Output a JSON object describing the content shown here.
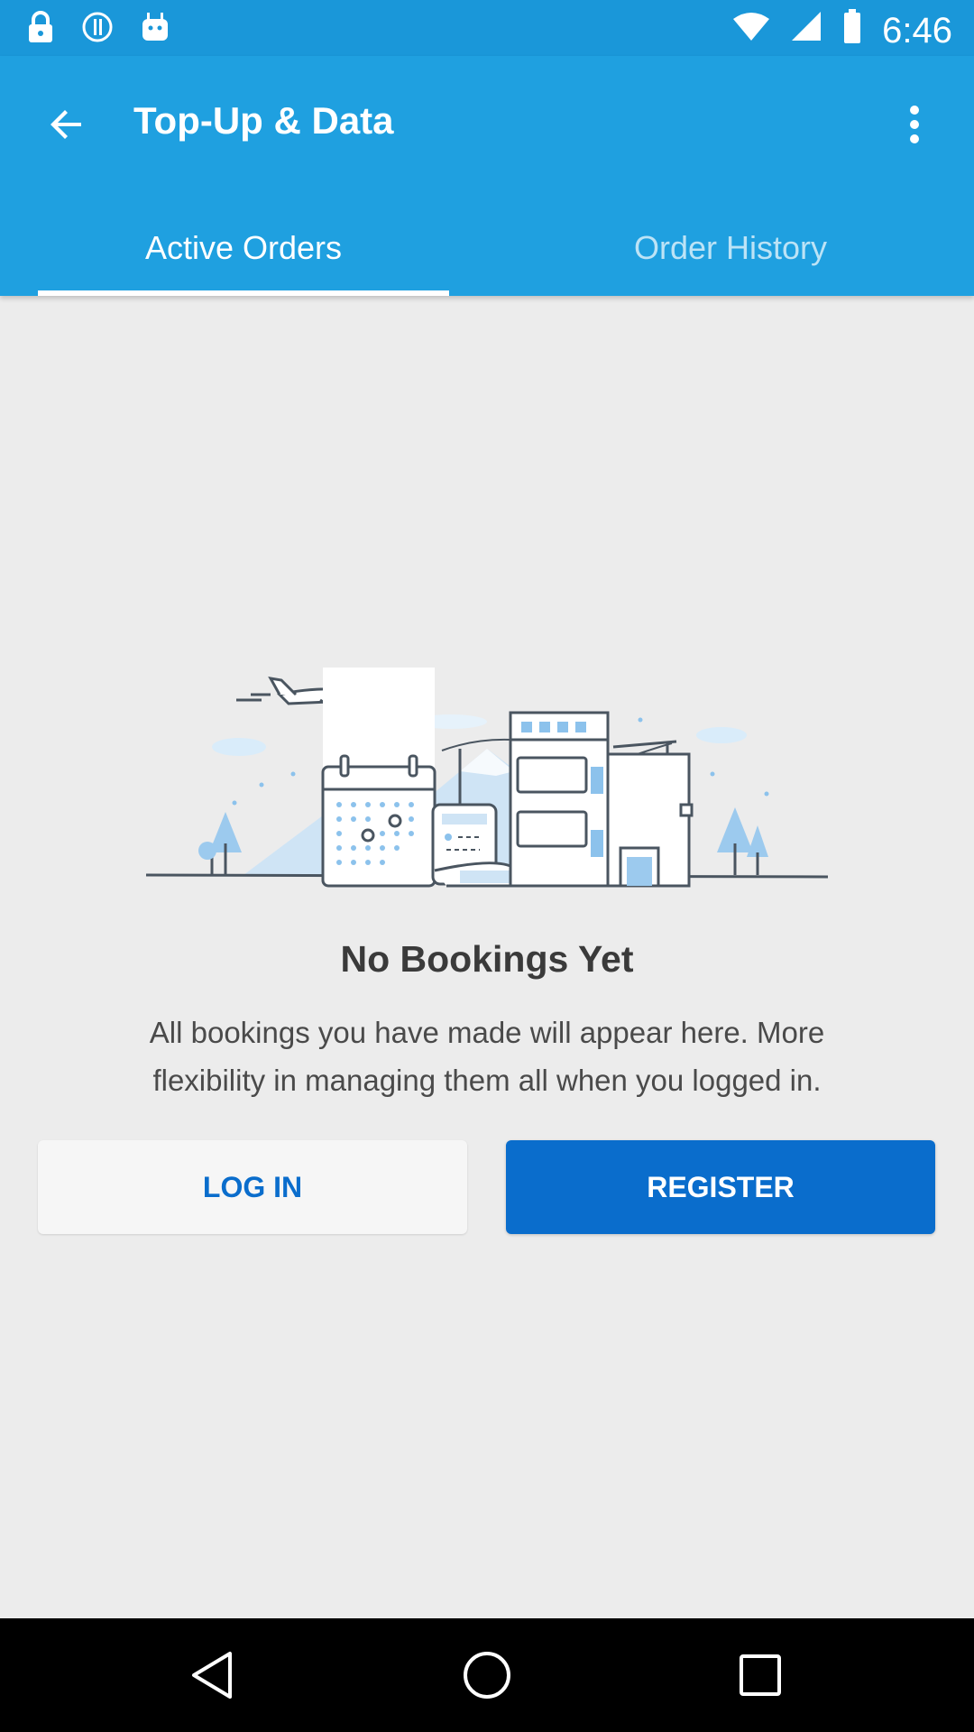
{
  "status_bar": {
    "time": "6:46",
    "icons": [
      "lock-icon",
      "alert-circle-icon",
      "android-icon",
      "wifi-icon",
      "signal-icon",
      "battery-icon"
    ]
  },
  "app_bar": {
    "title": "Top-Up & Data",
    "back_icon": "arrow-left-icon",
    "menu_icon": "more-vertical-icon"
  },
  "tabs": [
    {
      "label": "Active Orders",
      "active": true
    },
    {
      "label": "Order History",
      "active": false
    }
  ],
  "empty_state": {
    "illustration": "city-travel-illustration",
    "title": "No Bookings Yet",
    "description": "All bookings you have made will appear here. More flexibility in managing them all when you logged in."
  },
  "actions": {
    "login_label": "LOG IN",
    "register_label": "REGISTER"
  },
  "nav_bar": {
    "icons": [
      "back-triangle-icon",
      "home-circle-icon",
      "recents-square-icon"
    ]
  },
  "colors": {
    "status_bar": "#1a97d9",
    "app_bar": "#1fa0e0",
    "primary_button": "#0a6dcc",
    "background": "#ececec"
  }
}
